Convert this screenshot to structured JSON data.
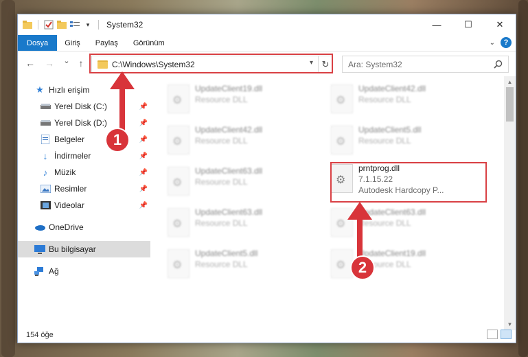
{
  "window": {
    "title": "System32",
    "controls": {
      "minimize": "—",
      "maximize": "☐",
      "close": "✕"
    }
  },
  "ribbon": {
    "tabs": [
      "Dosya",
      "Giriş",
      "Paylaş",
      "Görünüm"
    ],
    "help": "?"
  },
  "navigation": {
    "back": "←",
    "forward": "→",
    "recent": "⌄",
    "up": "↑",
    "address": "C:\\Windows\\System32",
    "search_placeholder": "Ara: System32"
  },
  "sidebar": {
    "items": [
      {
        "label": "Hızlı erişim",
        "icon": "star-icon",
        "pinned": false
      },
      {
        "label": "Yerel Disk (C:)",
        "icon": "drive-icon",
        "pinned": true
      },
      {
        "label": "Yerel Disk (D:)",
        "icon": "drive-icon",
        "pinned": true
      },
      {
        "label": "Belgeler",
        "icon": "documents-icon",
        "pinned": true
      },
      {
        "label": "İndirmeler",
        "icon": "download-icon",
        "pinned": true
      },
      {
        "label": "Müzik",
        "icon": "music-icon",
        "pinned": true
      },
      {
        "label": "Resimler",
        "icon": "pictures-icon",
        "pinned": true
      },
      {
        "label": "Videolar",
        "icon": "video-icon",
        "pinned": true
      },
      {
        "label": "OneDrive",
        "icon": "cloud-icon",
        "pinned": false
      },
      {
        "label": "Bu bilgisayar",
        "icon": "computer-icon",
        "pinned": false,
        "selected": true
      },
      {
        "label": "Ağ",
        "icon": "network-icon",
        "pinned": false
      }
    ]
  },
  "files": [
    {
      "name": "UpdateClient19.dll",
      "type": "Resource DLL",
      "blurred": true
    },
    {
      "name": "UpdateClient42.dll",
      "type": "Resource DLL",
      "blurred": true
    },
    {
      "name": "UpdateClient42.dll",
      "type": "Resource DLL",
      "blurred": true
    },
    {
      "name": "UpdateClient5.dll",
      "type": "Resource DLL",
      "blurred": true
    },
    {
      "name": "UpdateClient63.dll",
      "type": "Resource DLL",
      "blurred": true
    },
    {
      "name": "prntprog.dll",
      "version": "7.1.15.22",
      "type": "Autodesk Hardcopy P...",
      "blurred": false
    },
    {
      "name": "UpdateClient63.dll",
      "type": "Resource DLL",
      "blurred": true
    },
    {
      "name": "UpdateClient63.dll",
      "type": "Resource DLL",
      "blurred": true
    },
    {
      "name": "UpdateClient5.dll",
      "type": "Resource DLL",
      "blurred": true
    },
    {
      "name": "UpdateClient19.dll",
      "type": "Resource DLL",
      "blurred": true
    }
  ],
  "status": {
    "item_count": "154 öğe"
  },
  "callouts": {
    "one": "1",
    "two": "2"
  },
  "colors": {
    "accent": "#1979ca",
    "highlight": "#d94044",
    "selection": "#dcdcdc"
  }
}
